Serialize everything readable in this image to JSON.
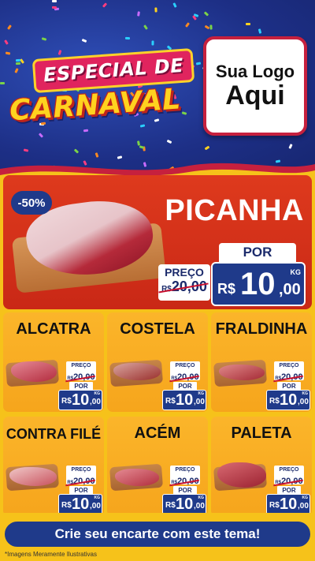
{
  "header": {
    "title_line1": "ESPECIAL DE",
    "title_line2": "CARNAVAL",
    "logo_line1": "Sua Logo",
    "logo_line2": "Aqui"
  },
  "hero": {
    "discount": "-50%",
    "product": "PICANHA",
    "old_label": "PREÇO",
    "old_currency": "R$",
    "old_price": "20,00",
    "por_label": "POR",
    "new_currency": "R$",
    "new_int": "10",
    "new_dec": ",00",
    "unit": "KG"
  },
  "products": [
    {
      "name": "ALCATRA",
      "old_label": "PREÇO",
      "old_currency": "R$",
      "old_price": "20,00",
      "por_label": "POR",
      "new_currency": "R$",
      "new_int": "10",
      "new_dec": ",00",
      "unit": "KG"
    },
    {
      "name": "COSTELA",
      "old_label": "PREÇO",
      "old_currency": "R$",
      "old_price": "20,00",
      "por_label": "POR",
      "new_currency": "R$",
      "new_int": "10",
      "new_dec": ",00",
      "unit": "KG"
    },
    {
      "name": "FRALDINHA",
      "old_label": "PREÇO",
      "old_currency": "R$",
      "old_price": "20,00",
      "por_label": "POR",
      "new_currency": "R$",
      "new_int": "10",
      "new_dec": ",00",
      "unit": "KG"
    },
    {
      "name": "CONTRA FILÉ",
      "old_label": "PREÇO",
      "old_currency": "R$",
      "old_price": "20,00",
      "por_label": "POR",
      "new_currency": "R$",
      "new_int": "10",
      "new_dec": ",00",
      "unit": "KG"
    },
    {
      "name": "ACÉM",
      "old_label": "PREÇO",
      "old_currency": "R$",
      "old_price": "20,00",
      "por_label": "POR",
      "new_currency": "R$",
      "new_int": "10",
      "new_dec": ",00",
      "unit": "KG"
    },
    {
      "name": "PALETA",
      "old_label": "PREÇO",
      "old_currency": "R$",
      "old_price": "20,00",
      "por_label": "POR",
      "new_currency": "R$",
      "new_int": "10",
      "new_dec": ",00",
      "unit": "KG"
    }
  ],
  "footer": {
    "cta": "Crie seu encarte com este tema!",
    "disclaimer": "*Imagens Meramente Ilustrativas"
  },
  "colors": {
    "header_blue": "#1d2f86",
    "hero_red": "#de3a1d",
    "card_orange": "#fbb52a",
    "price_blue": "#1f3a8a",
    "background_yellow": "#f6c21a"
  }
}
